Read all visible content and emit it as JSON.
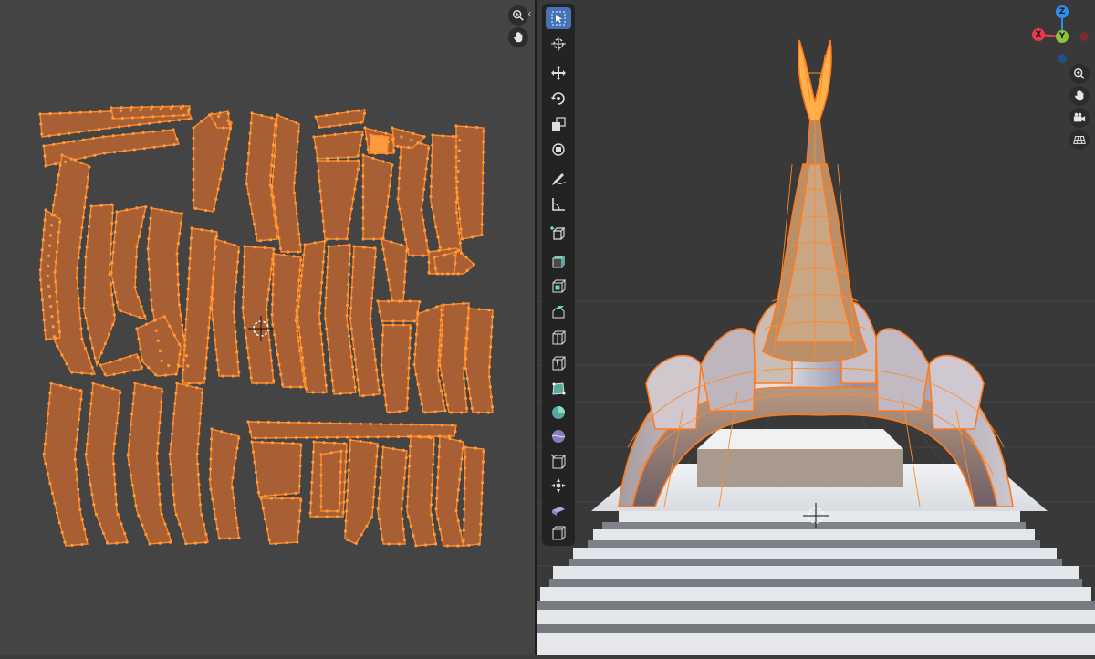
{
  "uv_editor": {
    "nav_buttons": [
      {
        "name": "zoom-icon"
      },
      {
        "name": "hand-pan-icon"
      }
    ],
    "collapse_glyph": "‹"
  },
  "viewport": {
    "gizmo": {
      "axes": [
        {
          "label": "Z",
          "color": "#2c8ff0"
        },
        {
          "label": "X",
          "color": "#f0384f"
        },
        {
          "label": "Y",
          "color": "#8bc540"
        }
      ]
    },
    "nav_buttons": [
      {
        "name": "zoom-icon"
      },
      {
        "name": "hand-pan-icon"
      },
      {
        "name": "camera-icon"
      },
      {
        "name": "grid-ortho-icon"
      }
    ],
    "toolbar": {
      "tools": [
        "select-box-icon",
        "cursor-icon",
        "move-icon",
        "rotate-icon",
        "scale-icon",
        "transform-icon",
        "annotate-icon",
        "measure-icon",
        "add-cube-icon",
        "extrude-region-icon",
        "inset-faces-icon",
        "bevel-icon",
        "loop-cut-icon",
        "knife-icon",
        "poly-build-icon",
        "spin-icon",
        "smooth-icon",
        "edge-slide-icon",
        "shrink-fatten-icon",
        "shear-icon",
        "rip-region-icon"
      ],
      "active_tool": "select-box-icon"
    },
    "colors": {
      "selection_orange": "#ff8a2a",
      "face_fill": "#b5693a",
      "marble": "#e4e6ea",
      "background": "#393939"
    }
  }
}
